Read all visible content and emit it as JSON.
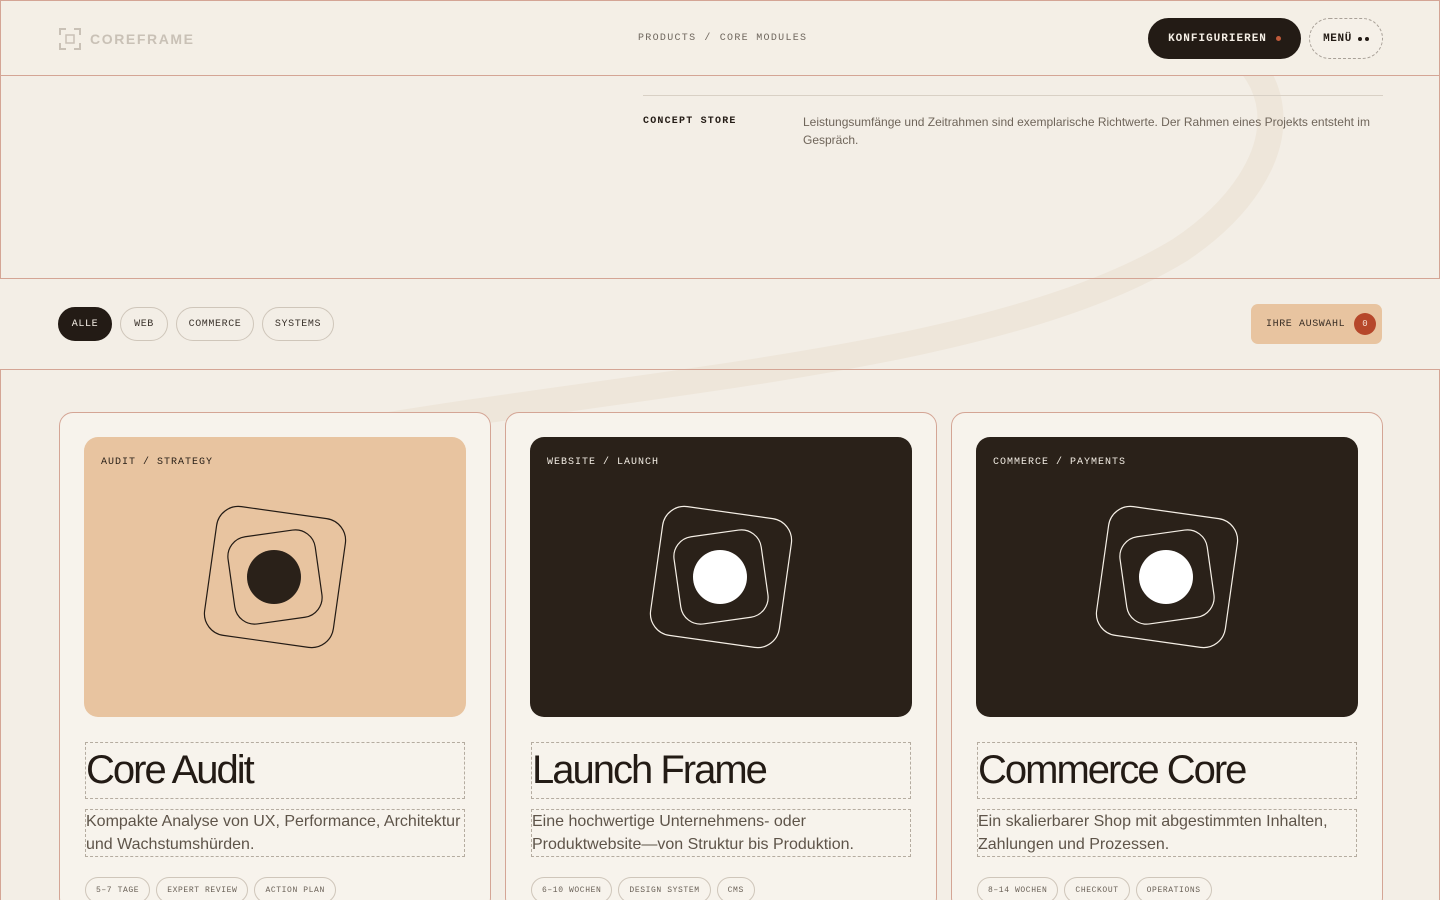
{
  "header": {
    "brand": "COREFRAME",
    "breadcrumb": [
      "PRODUCTS",
      "/",
      "CORE MODULES"
    ],
    "configure_label": "KONFIGURIEREN",
    "menu_label": "MENÜ"
  },
  "intro": {
    "label": "CONCEPT STORE",
    "text": "Leistungsumfänge und Zeitrahmen sind exemplarische Richtwerte. Der Rahmen eines Projekts entsteht im Gespräch."
  },
  "filters": {
    "chips": [
      {
        "label": "ALLE",
        "active": true
      },
      {
        "label": "WEB",
        "active": false
      },
      {
        "label": "COMMERCE",
        "active": false
      },
      {
        "label": "SYSTEMS",
        "active": false
      }
    ],
    "selection_label": "IHRE AUSWAHL",
    "selection_count": "0"
  },
  "cards": [
    {
      "tag": "AUDIT / STRATEGY",
      "title": "Core Audit",
      "description": "Kompakte Analyse von UX, Performance, Architektur und Wachstumshürden.",
      "pills": [
        "5–7 TAGE",
        "EXPERT REVIEW",
        "ACTION PLAN"
      ],
      "theme": "light"
    },
    {
      "tag": "WEBSITE / LAUNCH",
      "title": "Launch Frame",
      "description": "Eine hochwertige Unternehmens- oder Produktwebsite—von Struktur bis Produktion.",
      "pills": [
        "6–10 WOCHEN",
        "DESIGN SYSTEM",
        "CMS"
      ],
      "theme": "dark"
    },
    {
      "tag": "COMMERCE / PAYMENTS",
      "title": "Commerce Core",
      "description": "Ein skalierbarer Shop mit abgestimmten Inhalten, Zahlungen und Prozessen.",
      "pills": [
        "8–14 WOCHEN",
        "CHECKOUT",
        "OPERATIONS"
      ],
      "theme": "dark"
    }
  ],
  "colors": {
    "background": "#f3eee6",
    "ink": "#231b15",
    "accent": "#e8c4a0",
    "badge": "#b6472a",
    "border": "#d4a595"
  },
  "icons": [
    "logo-frame-icon",
    "dot-icon",
    "menu-dots-icon",
    "module-art-icon"
  ]
}
